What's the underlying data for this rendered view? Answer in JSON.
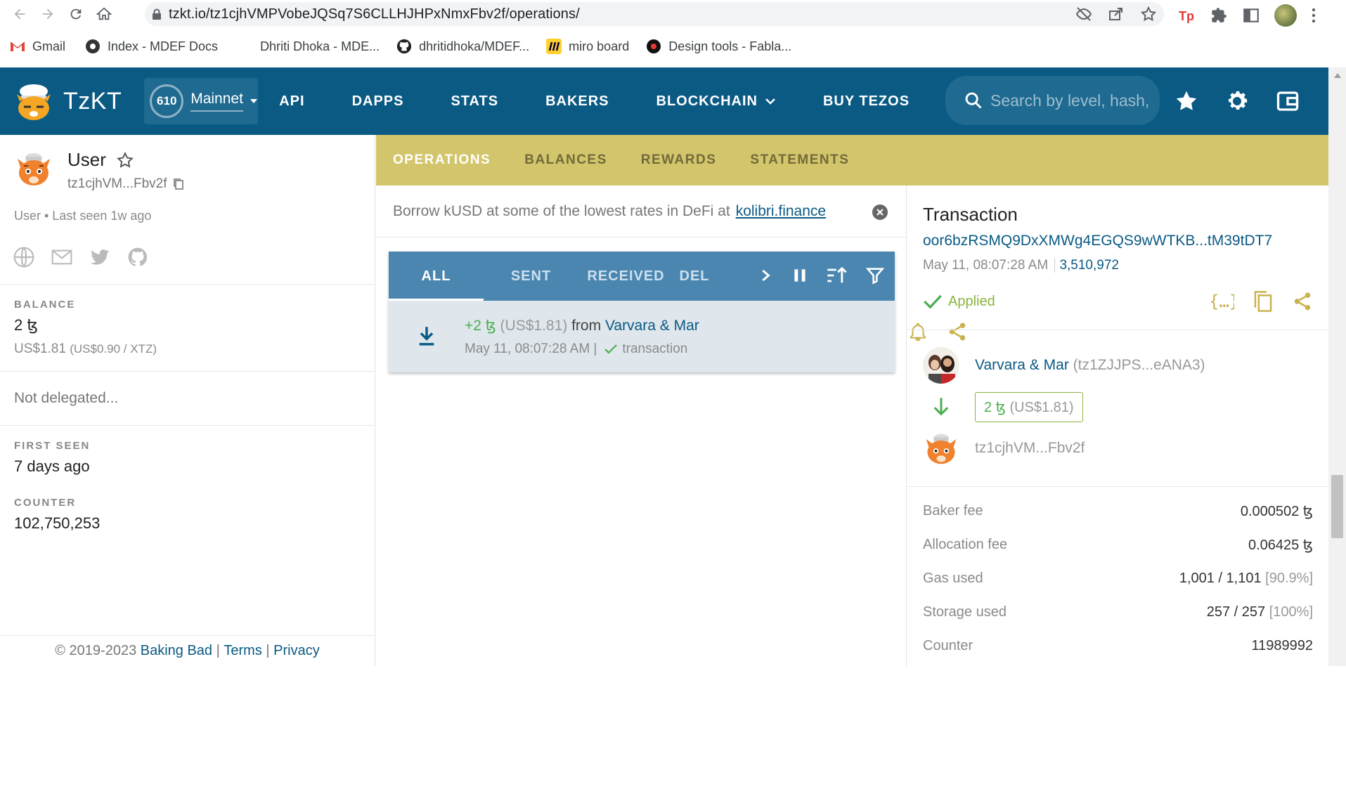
{
  "browser": {
    "url": "tzkt.io/tz1cjhVMPVobeJQSq7S6CLLHJHPxNmxFbv2f/operations/",
    "bookmarks": [
      {
        "label": "Gmail"
      },
      {
        "label": "Index - MDEF Docs"
      },
      {
        "label": "Dhriti Dhoka - MDE..."
      },
      {
        "label": "dhritidhoka/MDEF..."
      },
      {
        "label": "miro board"
      },
      {
        "label": "Design tools - Fabla..."
      }
    ]
  },
  "header": {
    "logo_text": "TzKT",
    "network_count": "610",
    "network_name": "Mainnet",
    "menu": [
      "API",
      "DAPPS",
      "STATS",
      "BAKERS",
      "BLOCKCHAIN",
      "BUY TEZOS"
    ],
    "search_placeholder": "Search by level, hash,"
  },
  "account": {
    "title": "User",
    "address_short": "tz1cjhVM...Fbv2f",
    "meta": "User • Last seen 1w ago",
    "balance_label": "BALANCE",
    "balance": "2 ꜩ",
    "balance_usd": "US$1.81",
    "balance_rate": "(US$0.90 / XTZ)",
    "delegation": "Not delegated...",
    "first_seen_label": "FIRST SEEN",
    "first_seen": "7 days ago",
    "counter_label": "COUNTER",
    "counter": "102,750,253"
  },
  "footer": {
    "copyright": "© 2019-2023",
    "baking_bad": "Baking Bad",
    "sep": "|",
    "terms": "Terms",
    "privacy": "Privacy"
  },
  "tabs": [
    "OPERATIONS",
    "BALANCES",
    "REWARDS",
    "STATEMENTS"
  ],
  "promo": {
    "text": "Borrow kUSD at some of the lowest rates in DeFi at",
    "link": "kolibri.finance"
  },
  "op_filters": [
    "ALL",
    "SENT",
    "RECEIVED",
    "DEL"
  ],
  "operation": {
    "amount": "+2 ꜩ",
    "usd": "(US$1.81)",
    "from_word": "from",
    "from": "Varvara & Mar",
    "time": "May 11, 08:07:28 AM |",
    "type": "transaction"
  },
  "detail": {
    "title": "Transaction",
    "hash": "oor6bzRSMQ9DxXMWg4EGQS9wWTKB...tM39tDT7",
    "time": "May 11, 08:07:28 AM",
    "level": "3,510,972",
    "status": "Applied",
    "sender_name": "Varvara & Mar",
    "sender_addr": "(tz1ZJJPS...eANA3)",
    "amount": "2 ꜩ",
    "amount_usd": "(US$1.81)",
    "receiver": "tz1cjhVM...Fbv2f",
    "fees": [
      {
        "k": "Baker fee",
        "v": "0.000502 ꜩ",
        "pct": ""
      },
      {
        "k": "Allocation fee",
        "v": "0.06425 ꜩ",
        "pct": ""
      },
      {
        "k": "Gas used",
        "v": "1,001 / 1,101",
        "pct": "[90.9%]"
      },
      {
        "k": "Storage used",
        "v": "257 / 257",
        "pct": "[100%]"
      },
      {
        "k": "Counter",
        "v": "11989992",
        "pct": ""
      }
    ]
  },
  "colors": {
    "header_bg": "#0a5a84",
    "tabs_bg": "#d3c56b",
    "op_tabs_bg": "#4a86b0",
    "success": "#8ab43e"
  }
}
